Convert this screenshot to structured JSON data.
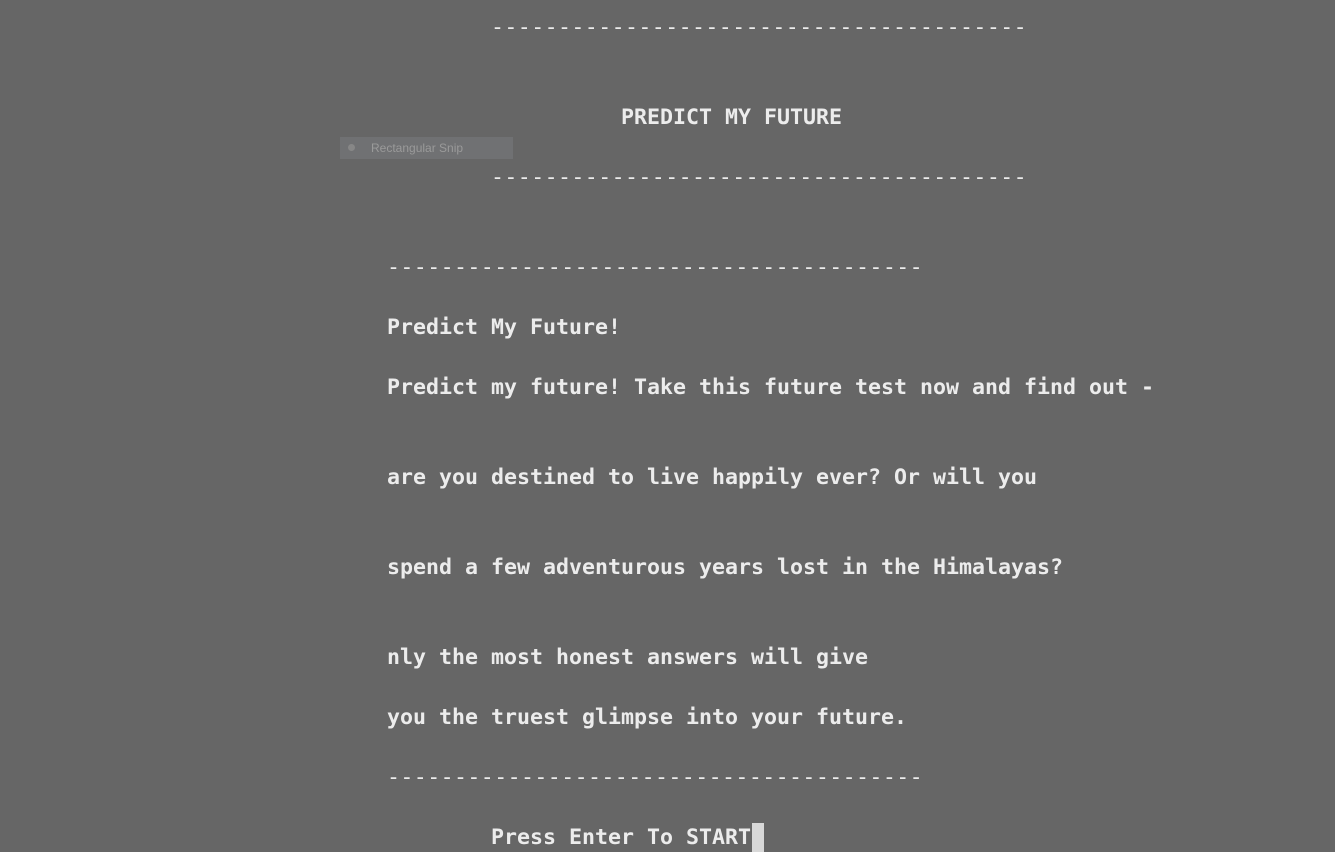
{
  "console": {
    "divider": "----------------------------------------",
    "header_title": "PREDICT MY FUTURE",
    "intro_title": "Predict My Future!",
    "body_lines": [
      "Predict my future! Take this future test now and find out -",
      "are you destined to live happily ever? Or will you",
      "spend a few adventurous years lost in the Himalayas?",
      "nly the most honest answers will give",
      "you the truest glimpse into your future."
    ],
    "prompt": "Press Enter To START"
  },
  "overlay": {
    "snip_label": "Rectangular Snip",
    "snip_icon": "snip-icon"
  }
}
